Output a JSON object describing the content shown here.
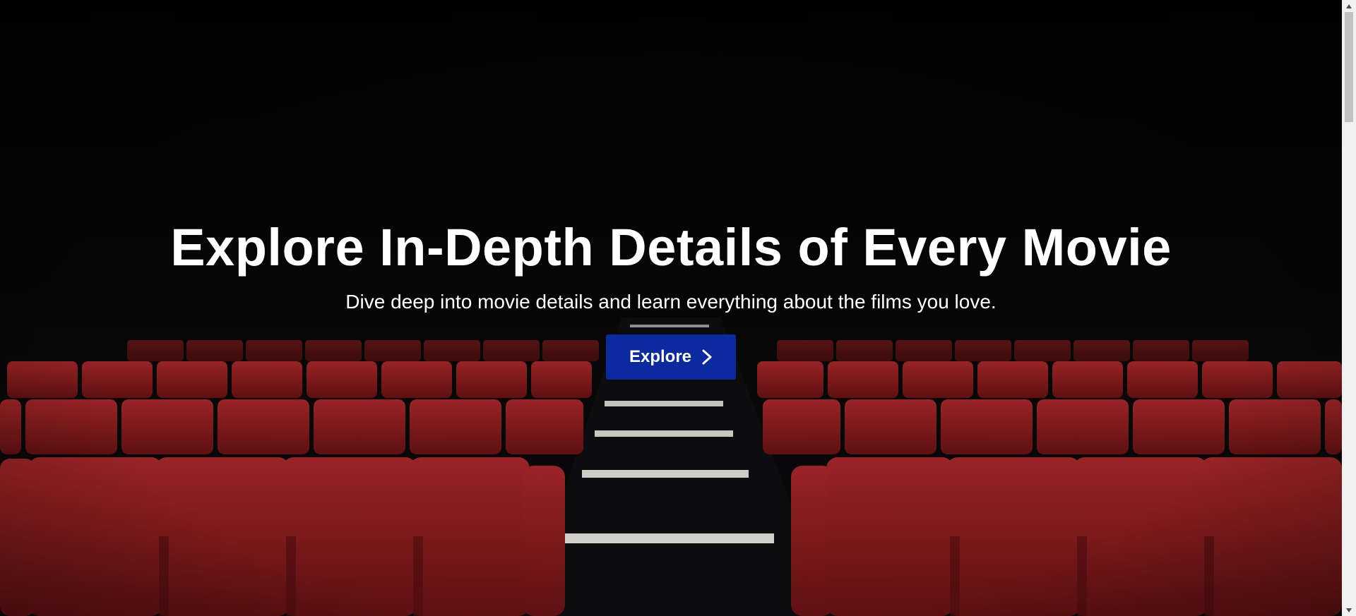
{
  "hero": {
    "title": "Explore In-Depth Details of Every Movie",
    "subtitle": "Dive deep into movie details and learn everything about the films you love.",
    "button_label": "Explore",
    "button_icon": "chevron-right-icon"
  },
  "background": {
    "scene": "theater-seats-image",
    "seat_color": "#8e1c1f",
    "button_color": "#0b2aa0"
  },
  "scrollbar": {
    "up_icon": "scroll-up-arrow-icon",
    "down_icon": "scroll-down-arrow-icon"
  }
}
